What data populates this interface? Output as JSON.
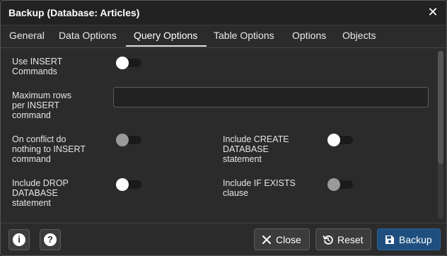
{
  "window": {
    "title": "Backup (Database: Articles)",
    "close_glyph": "✕"
  },
  "tabs": [
    {
      "label": "General",
      "active": false
    },
    {
      "label": "Data Options",
      "active": false
    },
    {
      "label": "Query Options",
      "active": true
    },
    {
      "label": "Table Options",
      "active": false
    },
    {
      "label": "Options",
      "active": false
    },
    {
      "label": "Objects",
      "active": false
    }
  ],
  "fields": {
    "use_insert": {
      "label_1": "Use INSERT",
      "label_2": "Commands",
      "on": false,
      "disabled": false
    },
    "max_rows": {
      "label_1": "Maximum rows",
      "label_2": "per INSERT",
      "label_3": "command",
      "value": ""
    },
    "on_conflict": {
      "label_1": "On conflict do",
      "label_2": "nothing to INSERT",
      "label_3": "command",
      "on": false,
      "disabled": true
    },
    "include_create": {
      "label_1": "Include CREATE",
      "label_2": "DATABASE",
      "label_3": "statement",
      "on": false,
      "disabled": false
    },
    "include_drop": {
      "label_1": "Include DROP",
      "label_2": "DATABASE",
      "label_3": "statement",
      "on": false,
      "disabled": false
    },
    "include_if_exists": {
      "label_1": "Include IF EXISTS",
      "label_2": "clause",
      "on": false,
      "disabled": true
    }
  },
  "footer": {
    "info_glyph": "i",
    "help_glyph": "?",
    "close_label": "Close",
    "reset_label": "Reset",
    "backup_label": "Backup"
  },
  "colors": {
    "primary_button": "#1e4f7f",
    "background": "#2b2b2b"
  }
}
